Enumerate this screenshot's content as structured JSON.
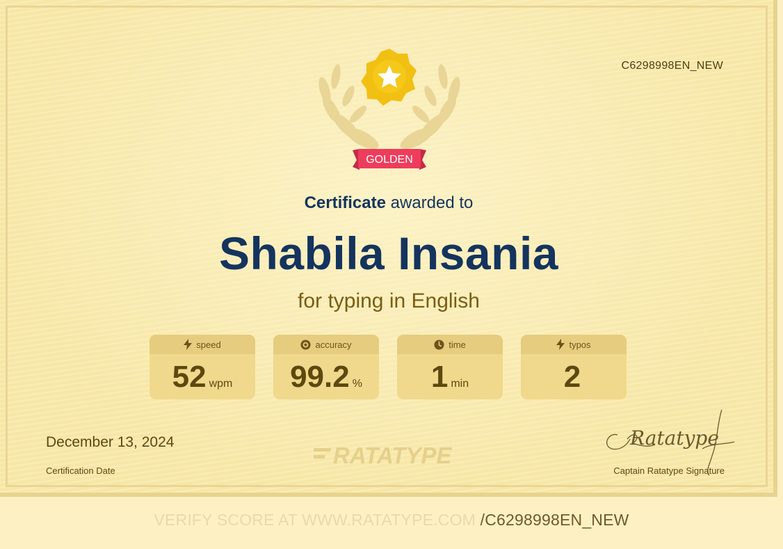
{
  "certificate": {
    "id": "C6298998EN_NEW",
    "badge_label": "GOLDEN",
    "headline_bold": "Certificate",
    "headline_rest": " awarded to",
    "recipient": "Shabila Insania",
    "subject": "for typing in English",
    "stats": [
      {
        "icon": "lightning-icon",
        "label": "speed",
        "value": "52",
        "unit": "wpm"
      },
      {
        "icon": "target-icon",
        "label": "accuracy",
        "value": "99.2",
        "unit": "%"
      },
      {
        "icon": "clock-icon",
        "label": "time",
        "value": "1",
        "unit": "min"
      },
      {
        "icon": "lightning-icon",
        "label": "typos",
        "value": "2",
        "unit": ""
      }
    ],
    "date": "December 13, 2024",
    "date_label": "Certification Date",
    "brand": "RATATYPE",
    "signature_text": "Ratatype",
    "signature_label": "Captain Ratatype Signature"
  },
  "footer": {
    "verify_prefix": "VERIFY SCORE AT WWW.RATATYPE.COM",
    "verify_code": "/C6298998EN_NEW"
  },
  "colors": {
    "background": "#f7e7a6",
    "navy": "#14345e",
    "gold_text": "#7b5d12",
    "star_badge": "#f2c012",
    "ribbon": "#ee3d5c",
    "stat_card": "#f0d98c"
  }
}
